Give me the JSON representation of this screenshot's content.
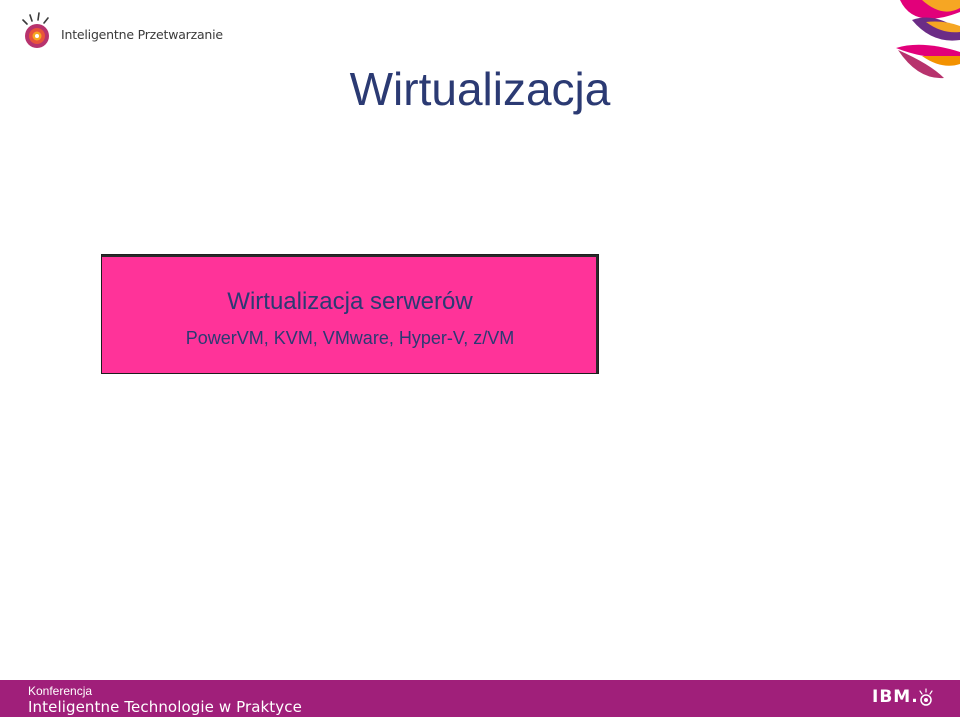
{
  "header": {
    "brand_text": "Inteligentne Przetwarzanie",
    "logo_icon": "smarter-planet-icon",
    "corner_icon": "decorative-petals-icon"
  },
  "slide": {
    "title": "Wirtualizacja"
  },
  "highlight_box": {
    "title": "Wirtualizacja serwerów",
    "subtitle": "PowerVM, KVM, VMware, Hyper-V, z/VM",
    "fill_color": "#ff3399"
  },
  "footer": {
    "line1": "Konferencja",
    "line2": "Inteligentne Technologie w Praktyce",
    "logo_text": "IBM.",
    "background_color": "#a01f7a"
  }
}
